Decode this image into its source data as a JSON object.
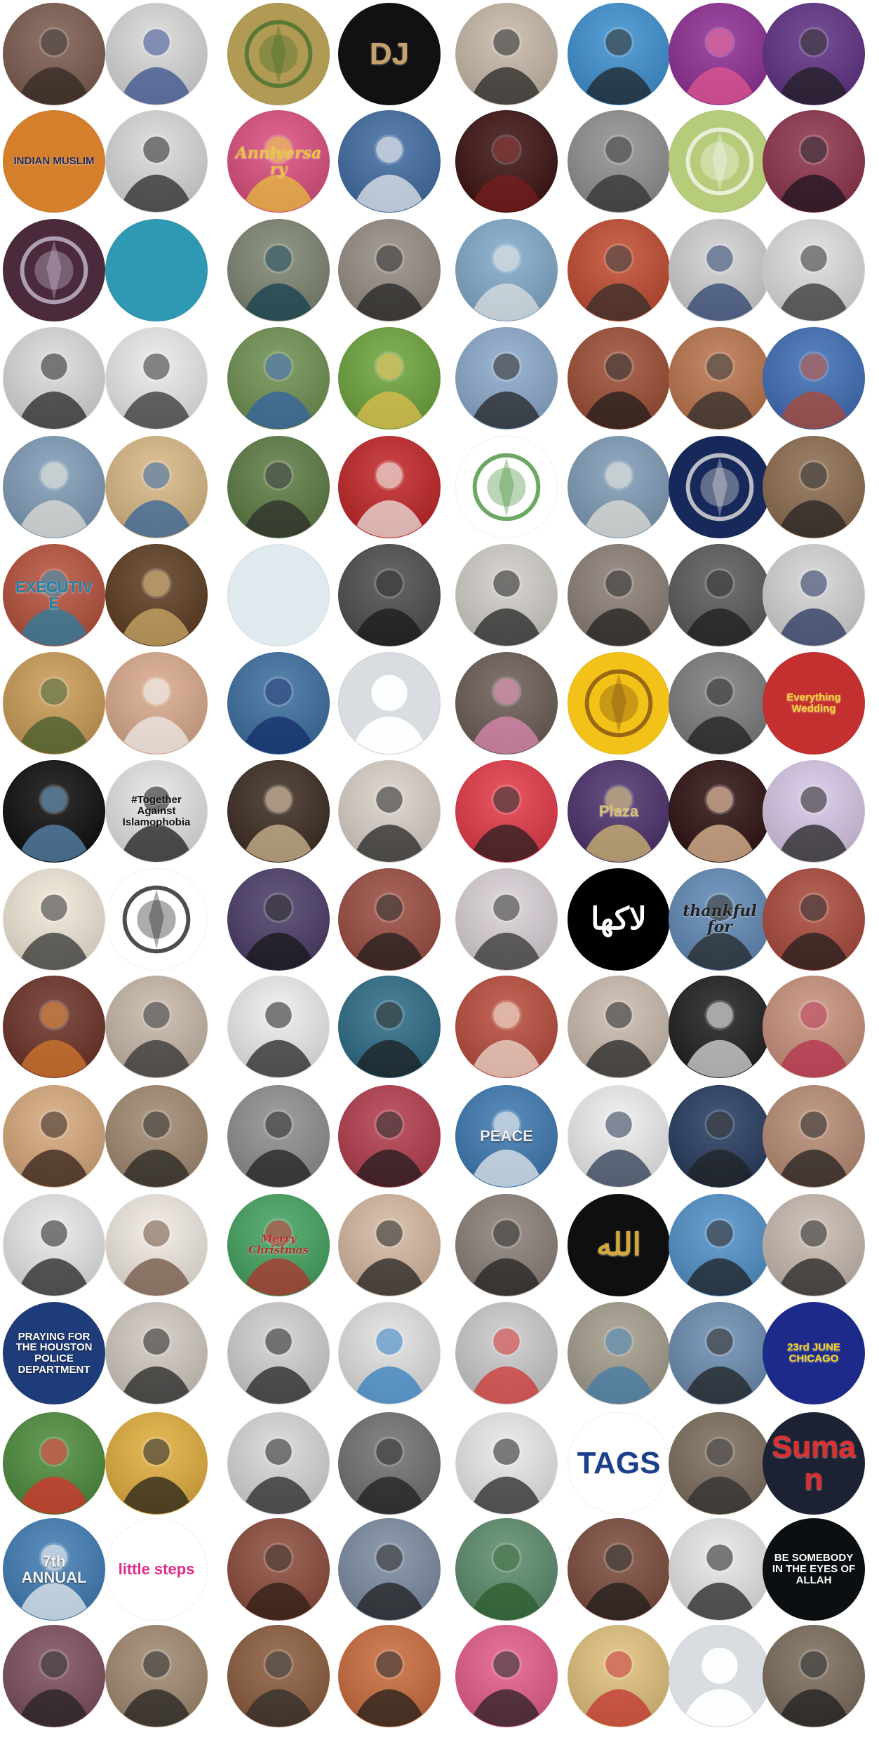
{
  "page": {
    "background": "#ffffff",
    "rows": 16,
    "cols": 8
  },
  "avatars": [
    {
      "kind": "photo",
      "bg": "#7b5a4e",
      "fg": "#2d2420"
    },
    {
      "kind": "photo",
      "bg": "#d7d7d7",
      "fg": "#31478a"
    },
    {
      "kind": "emblem",
      "bg": "#b19a53",
      "fg": "#3f6d29"
    },
    {
      "kind": "logo",
      "bg": "#111111",
      "fg": "#c4a26a",
      "text": "DJ"
    },
    {
      "kind": "photo",
      "bg": "#c6b7a7",
      "fg": "#1e1e1e"
    },
    {
      "kind": "photo",
      "bg": "#3b8fd0",
      "fg": "#1c1c1c"
    },
    {
      "kind": "photo",
      "bg": "#8d2c93",
      "fg": "#e5588e"
    },
    {
      "kind": "photo",
      "bg": "#5d2e82",
      "fg": "#1c1c1c"
    },
    {
      "kind": "logo",
      "bg": "#d47f2c",
      "fg": "#1f2b5f",
      "text": "INDIAN MUSLIM"
    },
    {
      "kind": "photo",
      "bg": "#d8d8d8",
      "fg": "#1f1f1f"
    },
    {
      "kind": "photo",
      "bg": "#da4c7c",
      "fg": "#e8c33c",
      "text": "Anniversary"
    },
    {
      "kind": "photo",
      "bg": "#3f6aa1",
      "fg": "#f0f0f0"
    },
    {
      "kind": "photo",
      "bg": "#3a0f0f",
      "fg": "#7a1e1e"
    },
    {
      "kind": "photo",
      "bg": "#8e8e8e",
      "fg": "#2b2b2b"
    },
    {
      "kind": "emblem",
      "bg": "#b7cc7a",
      "fg": "#fafafa"
    },
    {
      "kind": "photo",
      "bg": "#8c3148",
      "fg": "#17131e"
    },
    {
      "kind": "emblem",
      "bg": "#4b2a3c",
      "fg": "#cfc5d9"
    },
    {
      "kind": "logo",
      "bg": "#2f98b3",
      "fg": "#0f4e66"
    },
    {
      "kind": "photo",
      "bg": "#7c8370",
      "fg": "#0e3b4c"
    },
    {
      "kind": "photo",
      "bg": "#948b82",
      "fg": "#1d1d1d"
    },
    {
      "kind": "photo",
      "bg": "#80a8c7",
      "fg": "#e2e2e2"
    },
    {
      "kind": "photo",
      "bg": "#c1492e",
      "fg": "#2c2c2c"
    },
    {
      "kind": "photo",
      "bg": "#cfcfcf",
      "fg": "#223a6a"
    },
    {
      "kind": "photo",
      "bg": "#dcdcdc",
      "fg": "#2c2c2c"
    },
    {
      "kind": "photo",
      "bg": "#d9d9d9",
      "fg": "#1d1d1d"
    },
    {
      "kind": "photo",
      "bg": "#e9e9e9",
      "fg": "#2b2b2b"
    },
    {
      "kind": "photo",
      "bg": "#6d8f4f",
      "fg": "#315fa6"
    },
    {
      "kind": "photo",
      "bg": "#6ca33a",
      "fg": "#e6c04f"
    },
    {
      "kind": "photo",
      "bg": "#8aa8ca",
      "fg": "#1d1d1d"
    },
    {
      "kind": "photo",
      "bg": "#9b4b32",
      "fg": "#1a1a1a"
    },
    {
      "kind": "photo",
      "bg": "#b9734a",
      "fg": "#2a2a2a"
    },
    {
      "kind": "photo",
      "bg": "#3d6cb5",
      "fg": "#b3462b"
    },
    {
      "kind": "photo",
      "bg": "#7e9bb6",
      "fg": "#e4e2d8"
    },
    {
      "kind": "photo",
      "bg": "#d8b784",
      "fg": "#2b5f9b"
    },
    {
      "kind": "photo",
      "bg": "#5b7a42",
      "fg": "#2a2a2a"
    },
    {
      "kind": "photo",
      "bg": "#c02325",
      "fg": "#f0eee8"
    },
    {
      "kind": "emblem",
      "bg": "#ffffff",
      "fg": "#3b8a2f"
    },
    {
      "kind": "photo",
      "bg": "#7e9bb6",
      "fg": "#e4e2d8"
    },
    {
      "kind": "emblem",
      "bg": "#17295b",
      "fg": "#f1efe7"
    },
    {
      "kind": "photo",
      "bg": "#8b6a4e",
      "fg": "#1f1f1f"
    },
    {
      "kind": "photo",
      "bg": "#b54f3a",
      "fg": "#1f80a8",
      "text": "EXECUTIVE"
    },
    {
      "kind": "photo",
      "bg": "#5b3a1f",
      "fg": "#d3b16b"
    },
    {
      "kind": "logo",
      "bg": "#dfe9ee",
      "fg": "#1c4e7a"
    },
    {
      "kind": "photo",
      "bg": "#4b4b4b",
      "fg": "#161616"
    },
    {
      "kind": "photo",
      "bg": "#d0cdc6",
      "fg": "#1b1b1b"
    },
    {
      "kind": "photo",
      "bg": "#8a7d74",
      "fg": "#1b1b1b"
    },
    {
      "kind": "photo",
      "bg": "#585858",
      "fg": "#1a1a1a"
    },
    {
      "kind": "photo",
      "bg": "#d3d3d3",
      "fg": "#1e2e5a"
    },
    {
      "kind": "photo",
      "bg": "#c99a55",
      "fg": "#3c5a2a"
    },
    {
      "kind": "photo",
      "bg": "#d9a88b",
      "fg": "#f0f0f0"
    },
    {
      "kind": "photo",
      "bg": "#3a6d9f",
      "fg": "#0e2a66"
    },
    {
      "kind": "placeholder",
      "bg": "#d9dde1",
      "fg": "#ffffff"
    },
    {
      "kind": "photo",
      "bg": "#6a5a54",
      "fg": "#e48bb5"
    },
    {
      "kind": "emblem",
      "bg": "#f2c218",
      "fg": "#7a4a14"
    },
    {
      "kind": "photo",
      "bg": "#7a7a7a",
      "fg": "#1a1a1a"
    },
    {
      "kind": "logo",
      "bg": "#c42f2f",
      "fg": "#f4d62b",
      "text": "Everything Wedding"
    },
    {
      "kind": "photo",
      "bg": "#0a0a0a",
      "fg": "#5b8fb8"
    },
    {
      "kind": "photo",
      "bg": "#e3e3e3",
      "fg": "#111111",
      "text": "#Together Against Islamophobia"
    },
    {
      "kind": "photo",
      "bg": "#3b2a1f",
      "fg": "#d9c09a"
    },
    {
      "kind": "photo",
      "bg": "#d9d0c7",
      "fg": "#1d1d1d"
    },
    {
      "kind": "photo",
      "bg": "#e33745",
      "fg": "#1d1d1d"
    },
    {
      "kind": "photo",
      "bg": "#4a2f6a",
      "fg": "#d8c072",
      "text": "Plaza"
    },
    {
      "kind": "photo",
      "bg": "#2c0f0f",
      "fg": "#f0c7a0"
    },
    {
      "kind": "photo",
      "bg": "#d7c6e5",
      "fg": "#1a1a1a"
    },
    {
      "kind": "photo",
      "bg": "#efe7d6",
      "fg": "#2b2b2b"
    },
    {
      "kind": "emblem",
      "bg": "#ffffff",
      "fg": "#111111"
    },
    {
      "kind": "photo",
      "bg": "#4a3a66",
      "fg": "#141414"
    },
    {
      "kind": "photo",
      "bg": "#9a4a3e",
      "fg": "#1a1a1a"
    },
    {
      "kind": "photo",
      "bg": "#d9d0d6",
      "fg": "#2b2b2b"
    },
    {
      "kind": "logo",
      "bg": "#000000",
      "fg": "#ffffff",
      "text": "لاکھا"
    },
    {
      "kind": "photo",
      "bg": "#5f88b5",
      "fg": "#222222",
      "text": "thankful for"
    },
    {
      "kind": "photo",
      "bg": "#a9473a",
      "fg": "#1b1b1b"
    },
    {
      "kind": "photo",
      "bg": "#6a2f24",
      "fg": "#d97c2b"
    },
    {
      "kind": "photo",
      "bg": "#c6b7a7",
      "fg": "#2b2b2b"
    },
    {
      "kind": "photo",
      "bg": "#ececec",
      "fg": "#1a1a1a"
    },
    {
      "kind": "photo",
      "bg": "#2b6a85",
      "fg": "#1a1a1a"
    },
    {
      "kind": "photo",
      "bg": "#b84a3a",
      "fg": "#f0e1d4"
    },
    {
      "kind": "photo",
      "bg": "#c9b9ab",
      "fg": "#1d1d1d"
    },
    {
      "kind": "photo",
      "bg": "#1c1c1c",
      "fg": "#e6e6e6"
    },
    {
      "kind": "photo",
      "bg": "#c88f7a",
      "fg": "#b32b4a"
    },
    {
      "kind": "photo",
      "bg": "#d6a77a",
      "fg": "#2a1a14"
    },
    {
      "kind": "photo",
      "bg": "#a0886e",
      "fg": "#1f1f1f"
    },
    {
      "kind": "photo",
      "bg": "#8d8d8d",
      "fg": "#1a1a1a"
    },
    {
      "kind": "photo",
      "bg": "#b23a4b",
      "fg": "#1a1a1a"
    },
    {
      "kind": "photo",
      "bg": "#3b78b0",
      "fg": "#f0f0f0",
      "text": "PEACE"
    },
    {
      "kind": "photo",
      "bg": "#ededed",
      "fg": "#22334d"
    },
    {
      "kind": "photo",
      "bg": "#23395d",
      "fg": "#1f1f1f"
    },
    {
      "kind": "photo",
      "bg": "#b68a73",
      "fg": "#1a1a1a"
    },
    {
      "kind": "photo",
      "bg": "#e6e6e6",
      "fg": "#1a1a1a"
    },
    {
      "kind": "photo",
      "bg": "#f0e9e1",
      "fg": "#6a4c3a"
    },
    {
      "kind": "photo",
      "bg": "#41a15e",
      "fg": "#b82b2b",
      "text": "Merry Christmas"
    },
    {
      "kind": "photo",
      "bg": "#d4b79f",
      "fg": "#1a1a1a"
    },
    {
      "kind": "photo",
      "bg": "#8a7e77",
      "fg": "#1d1d1d"
    },
    {
      "kind": "logo",
      "bg": "#0f0f0f",
      "fg": "#d4a83c",
      "text": "الله"
    },
    {
      "kind": "photo",
      "bg": "#4f8fc7",
      "fg": "#1a1a1a"
    },
    {
      "kind": "photo",
      "bg": "#c6b8ae",
      "fg": "#1d1d1d"
    },
    {
      "kind": "logo",
      "bg": "#1e3c7a",
      "fg": "#ffffff",
      "text": "PRAYING FOR THE HOUSTON POLICE DEPARTMENT"
    },
    {
      "kind": "photo",
      "bg": "#d0c8bf",
      "fg": "#1c1c1c"
    },
    {
      "kind": "photo",
      "bg": "#cfcfcf",
      "fg": "#1a1a1a"
    },
    {
      "kind": "photo",
      "bg": "#e0e0e0",
      "fg": "#2a7abf"
    },
    {
      "kind": "photo",
      "bg": "#c9c9c9",
      "fg": "#d12c2c"
    },
    {
      "kind": "photo",
      "bg": "#a39c8b",
      "fg": "#3a79a9"
    },
    {
      "kind": "photo",
      "bg": "#6a8bb0",
      "fg": "#1a1a1a"
    },
    {
      "kind": "logo",
      "bg": "#1e2a8a",
      "fg": "#f4d21b",
      "text": "23rd JUNE CHICAGO"
    },
    {
      "kind": "photo",
      "bg": "#4b8a3a",
      "fg": "#e12b2b"
    },
    {
      "kind": "photo",
      "bg": "#e0ad3a",
      "fg": "#1a1a1a"
    },
    {
      "kind": "photo",
      "bg": "#d6d6d6",
      "fg": "#1c1c1c"
    },
    {
      "kind": "photo",
      "bg": "#6f6f6f",
      "fg": "#1a1a1a"
    },
    {
      "kind": "photo",
      "bg": "#e8e8e8",
      "fg": "#1c1c1c"
    },
    {
      "kind": "logo",
      "bg": "#ffffff",
      "fg": "#1c3f8a",
      "text": "TAGS"
    },
    {
      "kind": "photo",
      "bg": "#7b6b5a",
      "fg": "#2b2b2b"
    },
    {
      "kind": "logo",
      "bg": "#1c2233",
      "fg": "#e02d2d",
      "text": "Suman"
    },
    {
      "kind": "photo",
      "bg": "#3e7bb3",
      "fg": "#f2f2f2",
      "text": "7th ANNUAL"
    },
    {
      "kind": "logo",
      "bg": "#ffffff",
      "fg": "#e12b8a",
      "text": "little steps"
    },
    {
      "kind": "photo",
      "bg": "#8a4a3a",
      "fg": "#2a1a14"
    },
    {
      "kind": "photo",
      "bg": "#7a8aa0",
      "fg": "#1a1a1a"
    },
    {
      "kind": "photo",
      "bg": "#5a8a6a",
      "fg": "#2a5a2a"
    },
    {
      "kind": "photo",
      "bg": "#7a4a3a",
      "fg": "#1a1a1a"
    },
    {
      "kind": "photo",
      "bg": "#e6e6e6",
      "fg": "#1a1a1a"
    },
    {
      "kind": "logo",
      "bg": "#0b0f12",
      "fg": "#ffffff",
      "text": "BE SOMEBODY IN THE EYES OF ALLAH"
    },
    {
      "kind": "photo",
      "bg": "#7b4c5c",
      "fg": "#1e1e1e"
    },
    {
      "kind": "photo",
      "bg": "#a0886e",
      "fg": "#1c1c1c"
    },
    {
      "kind": "photo",
      "bg": "#8a5a3a",
      "fg": "#2a2a2a"
    },
    {
      "kind": "photo",
      "bg": "#c96a3a",
      "fg": "#1a1a1a"
    },
    {
      "kind": "photo",
      "bg": "#e35a8a",
      "fg": "#1c1c1c"
    },
    {
      "kind": "photo",
      "bg": "#e0c07a",
      "fg": "#c22b2b"
    },
    {
      "kind": "placeholder",
      "bg": "#d9dde1",
      "fg": "#ffffff"
    },
    {
      "kind": "photo",
      "bg": "#7a6a5a",
      "fg": "#1a1a1a"
    }
  ]
}
